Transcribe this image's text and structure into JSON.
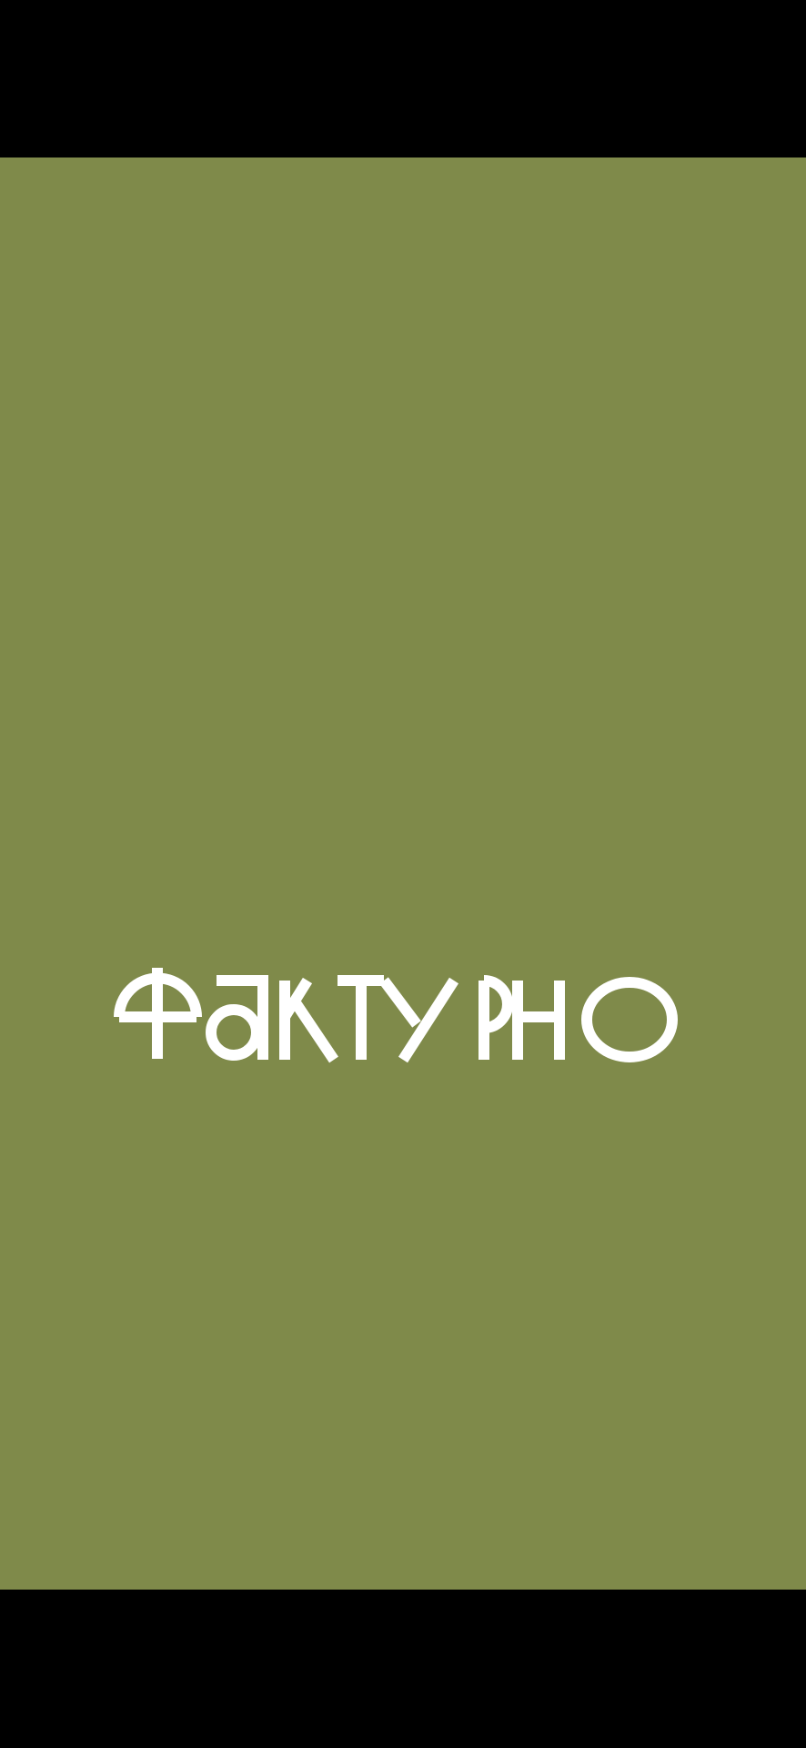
{
  "splash": {
    "background_color": "#7f8a4a",
    "letterbox_color": "#000000"
  },
  "logo": {
    "wordmark": "ФАКТУРНО",
    "color": "#ffffff"
  }
}
